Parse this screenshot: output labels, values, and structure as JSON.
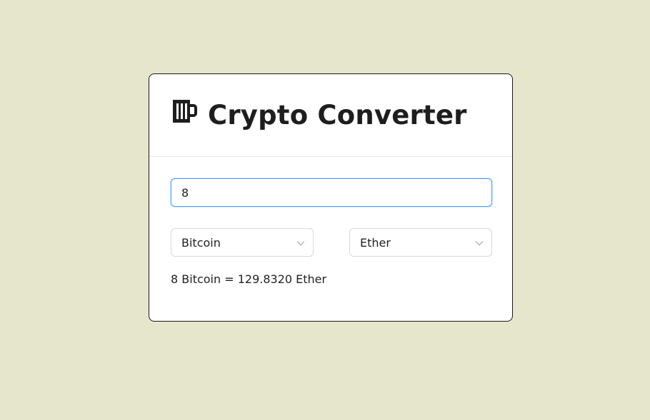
{
  "header": {
    "title": "Crypto Converter",
    "icon": "beer-mug-icon"
  },
  "form": {
    "amount_value": "8",
    "from_currency": "Bitcoin",
    "to_currency": "Ether",
    "result_text": "8 Bitcoin = 129.8320 Ether"
  },
  "colors": {
    "background": "#e6e6cc",
    "card": "#ffffff",
    "focus_border": "#4d9fff",
    "text": "#1e1e1e"
  }
}
